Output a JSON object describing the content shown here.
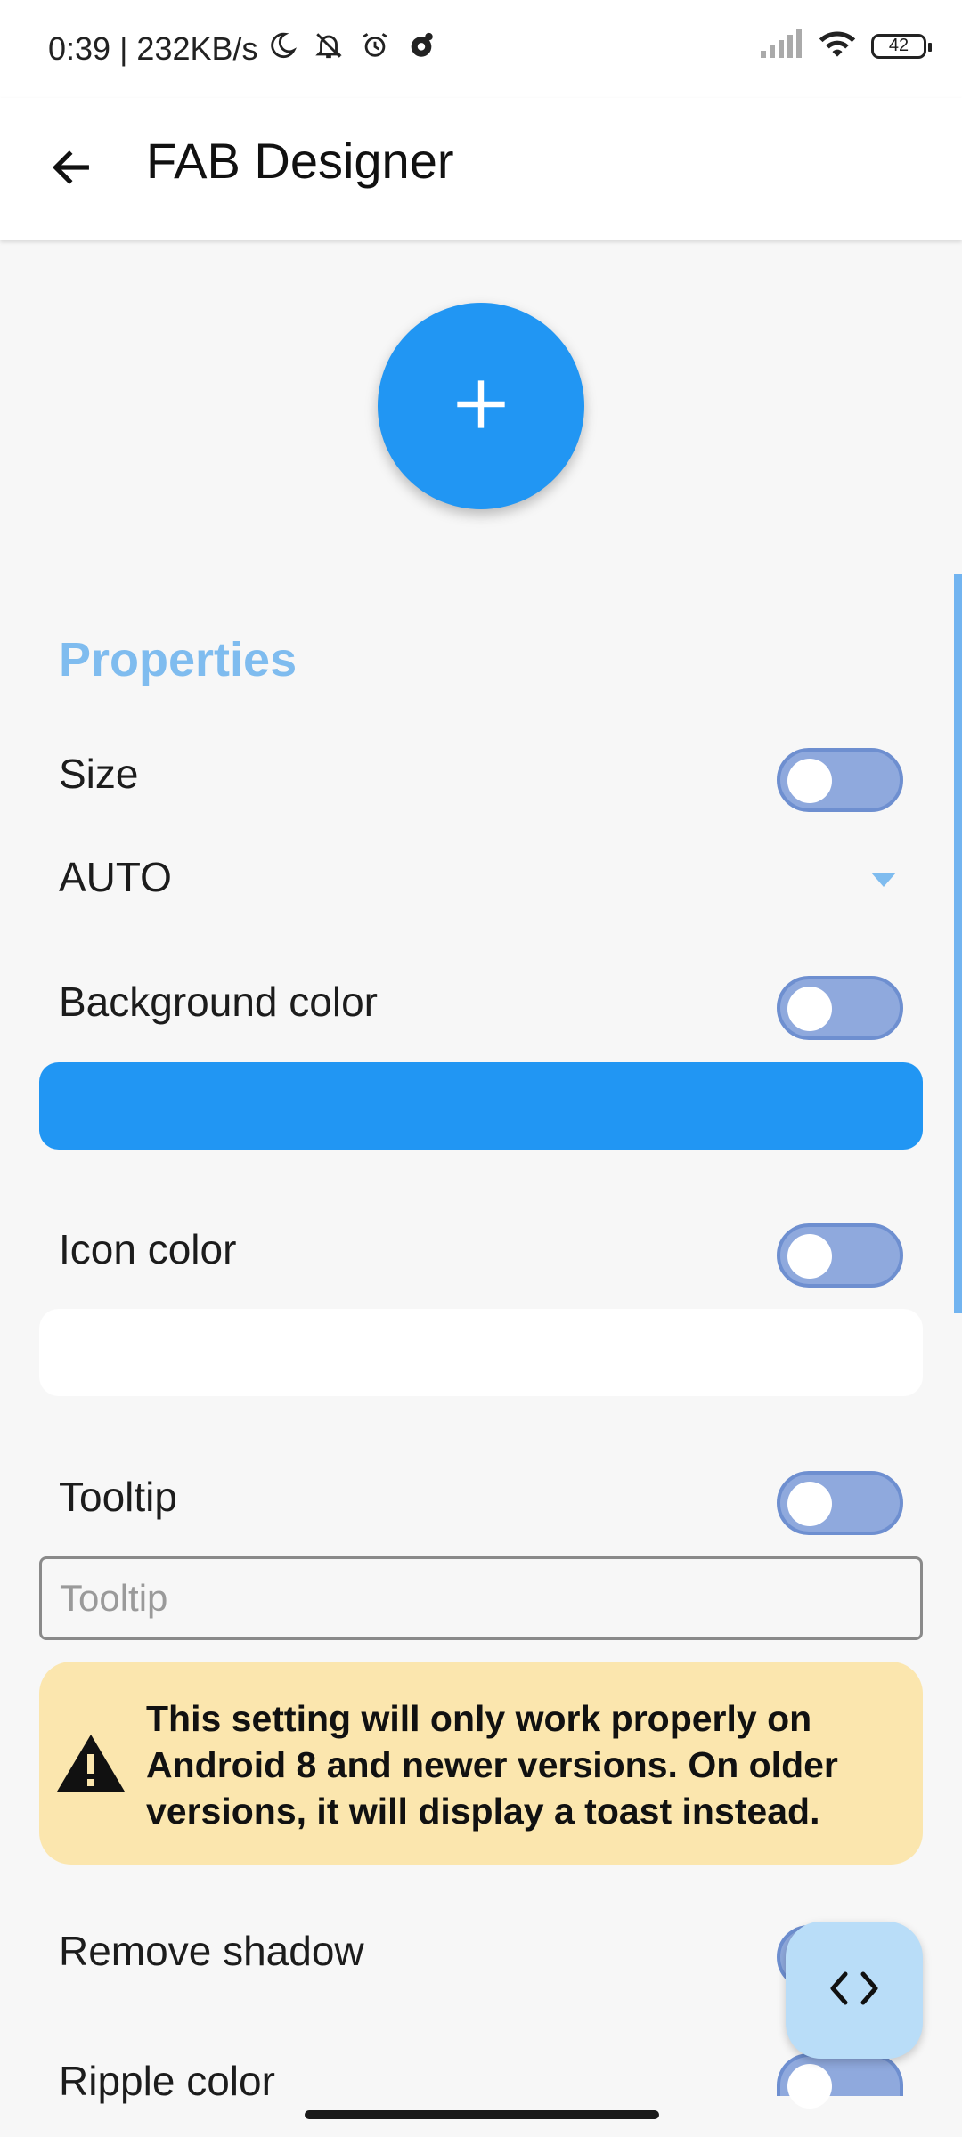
{
  "status_bar": {
    "time_speed": "0:39 | 232KB/s",
    "battery": "42",
    "icons_left": [
      "moon-icon",
      "bell-off-icon",
      "alarm-icon",
      "app-notification-icon"
    ],
    "icons_right": [
      "signal-icon",
      "wifi-icon",
      "battery-icon"
    ]
  },
  "app_bar": {
    "title": "FAB Designer",
    "back_icon": "arrow-left-icon"
  },
  "preview": {
    "icon": "plus-icon",
    "color": "#2196f3"
  },
  "properties": {
    "section_title": "Properties",
    "size": {
      "label": "Size",
      "toggle_on": false,
      "dropdown_value": "AUTO"
    },
    "background_color": {
      "label": "Background color",
      "toggle_on": false,
      "color": "#2196f3"
    },
    "icon_color": {
      "label": "Icon color",
      "toggle_on": false,
      "color": "#ffffff"
    },
    "tooltip": {
      "label": "Tooltip",
      "toggle_on": false,
      "placeholder": "Tooltip",
      "value": ""
    },
    "warning": {
      "icon": "warning-icon",
      "text": "This setting will only work properly on Android 8 and newer versions. On older versions, it will display a toast instead."
    },
    "remove_shadow": {
      "label": "Remove shadow",
      "toggle_on": false
    },
    "ripple_color": {
      "label": "Ripple color",
      "toggle_on": false
    }
  },
  "code_fab": {
    "icon": "code-brackets-icon"
  },
  "colors": {
    "accent": "#2196f3",
    "section_title": "#7fbcef",
    "toggle_track": "#8fa9dd",
    "warning_bg": "#fbe6ae",
    "code_fab_bg": "#b9ddf8"
  }
}
